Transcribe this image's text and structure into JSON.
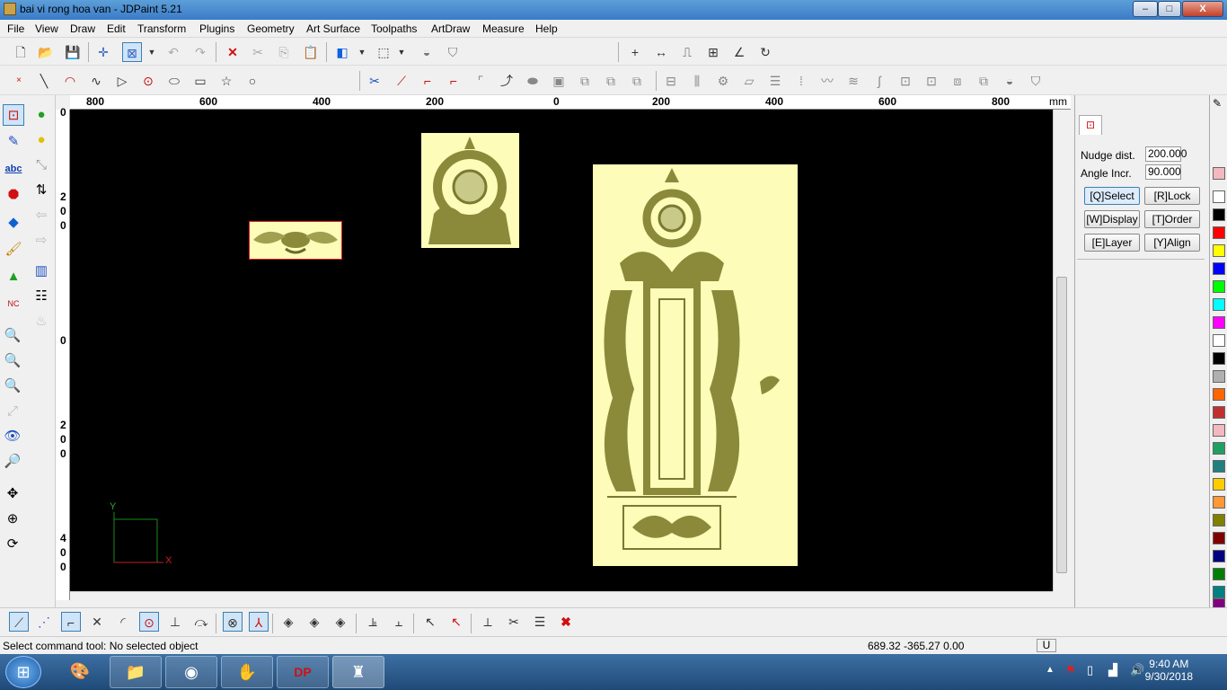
{
  "window": {
    "title": "bai vi rong hoa van - JDPaint 5.21",
    "min_label": "–",
    "max_label": "□",
    "close_label": "X"
  },
  "menu": [
    "File",
    "View",
    "Draw",
    "Edit",
    "Transform",
    "Plugins",
    "Geometry",
    "Art Surface",
    "Toolpaths",
    "ArtDraw",
    "Measure",
    "Help"
  ],
  "ruler": {
    "h_labels": [
      "800",
      "600",
      "400",
      "200",
      "0",
      "200",
      "400",
      "600",
      "800"
    ],
    "unit": "mm",
    "v_labels": [
      "0",
      "2",
      "0",
      "0",
      "0",
      "2",
      "0",
      "0",
      "4",
      "0",
      "0"
    ]
  },
  "canvas": {
    "axis_y": "Y",
    "axis_x": "X"
  },
  "panel": {
    "nudge_label": "Nudge dist.",
    "nudge_value": "200.000",
    "angle_label": "Angle Incr.",
    "angle_value": "90.000",
    "buttons": [
      "[Q]Select",
      "[R]Lock",
      "[W]Display",
      "[T]Order",
      "[E]Layer",
      "[Y]Align"
    ]
  },
  "palette": [
    "#f4b8c0",
    "#ffffff",
    "#000000",
    "#ff0000",
    "#ffff00",
    "#0000ff",
    "#00ff00",
    "#00ffff",
    "#ff00ff",
    "#ffffff",
    "#000000",
    "#b0b0b0",
    "#ff6600",
    "#c03030",
    "#f4b8c0",
    "#20a060",
    "#208080",
    "#ffcc00",
    "#ff9933",
    "#808000",
    "#800000",
    "#000080",
    "#008000",
    "#008080",
    "#800080"
  ],
  "status": {
    "message": "Select command tool: No selected object",
    "coords": "689.32 -365.27 0.00",
    "mode": "U"
  },
  "taskbar": {
    "time": "9:40 AM",
    "date": "9/30/2018"
  }
}
